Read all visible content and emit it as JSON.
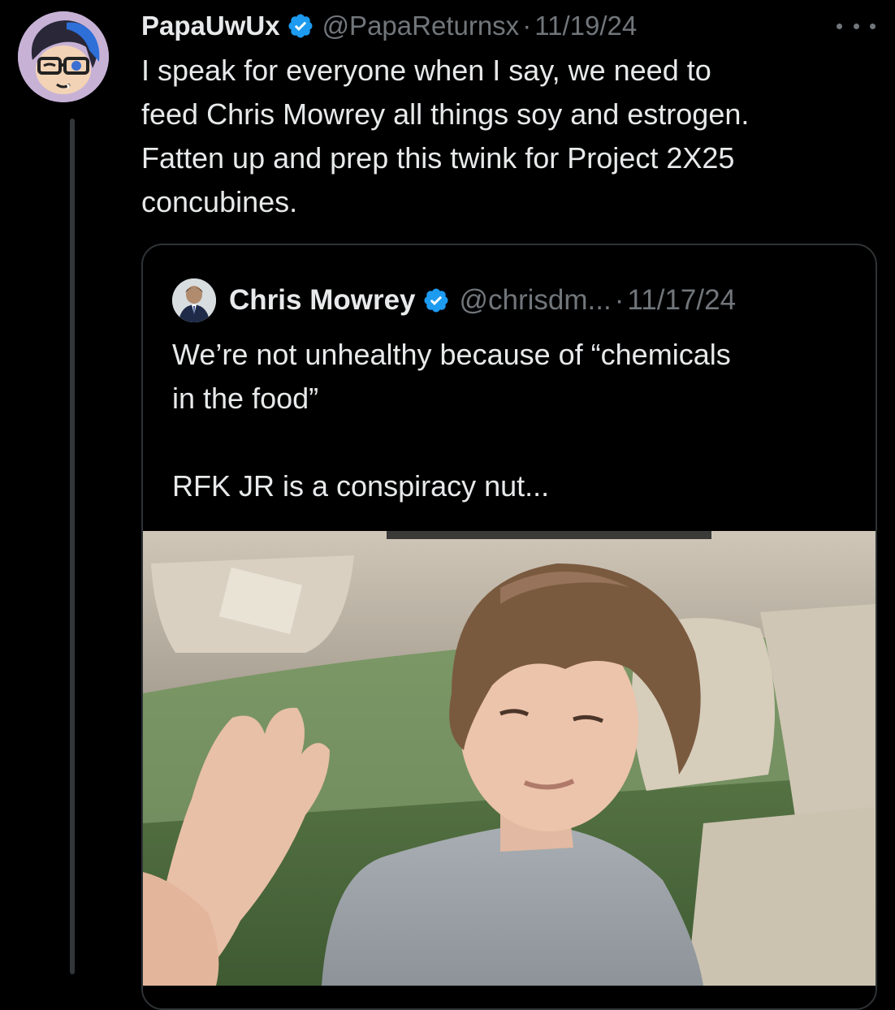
{
  "tweet": {
    "display_name": "PapaUwUx",
    "handle": "@PapaReturnsx",
    "separator": "·",
    "date": "11/19/24",
    "text": "I speak for everyone when I say, we need to\nfeed Chris Mowrey all things soy and estrogen.\nFatten up and prep this twink for Project 2X25\nconcubines.",
    "more_icon": "more-horizontal-icon",
    "verified_icon": "verified-badge-icon"
  },
  "quoted_tweet": {
    "display_name": "Chris Mowrey",
    "handle": "@chrisdm...",
    "separator": "·",
    "date": "11/17/24",
    "text": "We’re not unhealthy because of “chemicals\nin the food”\n\nRFK JR is a conspiracy nut...",
    "media": "video-thumbnail"
  },
  "colors": {
    "background": "#000000",
    "text_primary": "#e7e9ea",
    "text_secondary": "#71767b",
    "verified_blue": "#1d9bf0",
    "border": "#2f3336",
    "thread_line": "#333639"
  }
}
